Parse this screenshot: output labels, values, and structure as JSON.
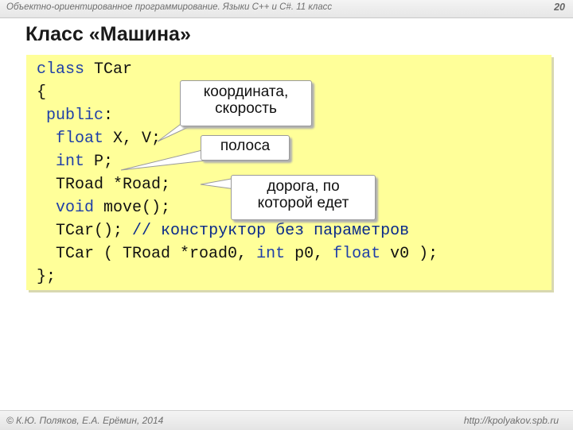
{
  "header": {
    "subtitle": "Объектно-ориентированное программирование. Языки C++ и C#. 11 класс",
    "page_number": "20"
  },
  "slide": {
    "title": "Класс «Машина»"
  },
  "code": {
    "line1_kw": "class",
    "line1_rest": " TCar",
    "line2": "{",
    "line3_kw": "public",
    "line3_rest": ":",
    "line4_kw": "float",
    "line4_rest": " X, V;",
    "line5_kw": "int",
    "line5_rest": " P;",
    "line6": "TRoad *Road;",
    "line7_kw": "void",
    "line7_rest": " move();",
    "line8_code": "TCar();",
    "line8_comment": "// конструктор без параметров",
    "line9_a": "TCar ( TRoad *road0, ",
    "line9_kw1": "int",
    "line9_b": " p0, ",
    "line9_kw2": "float",
    "line9_c": " v0 );",
    "line10": "};"
  },
  "callouts": {
    "coords_line1": "координата,",
    "coords_line2": "скорость",
    "lane": "полоса",
    "road_line1": "дорога, по",
    "road_line2": "которой едет"
  },
  "footer": {
    "copyright": "© К.Ю. Поляков, Е.А. Ерёмин, 2014",
    "url": "http://kpolyakov.spb.ru"
  },
  "colors": {
    "code_background": "#ffff99",
    "keyword": "#1f3fa8",
    "callout_background": "#ffffff"
  }
}
